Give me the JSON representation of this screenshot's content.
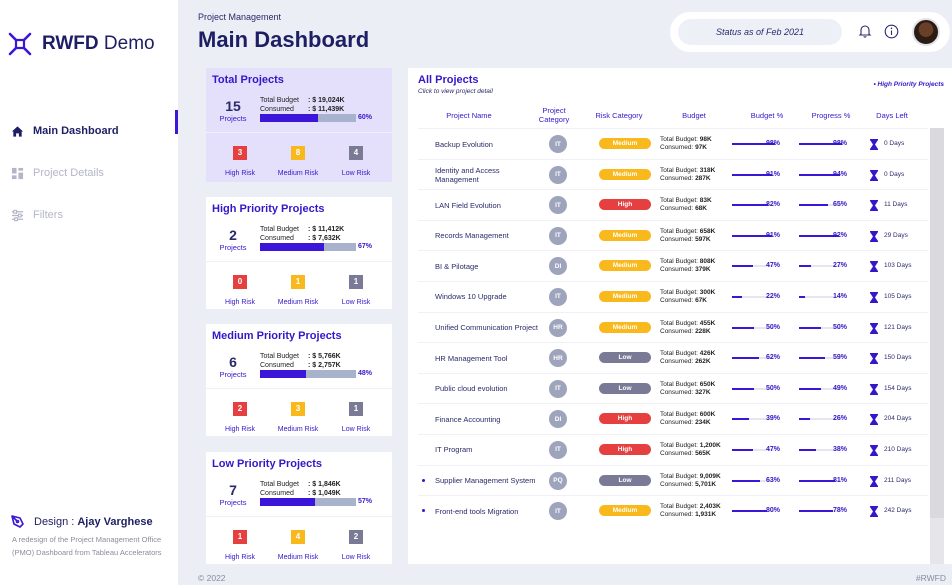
{
  "brand": {
    "bold": "RWFD",
    "rest": " Demo"
  },
  "nav": [
    {
      "label": "Main Dashboard",
      "icon": "home-icon",
      "active": true
    },
    {
      "label": "Project Details",
      "icon": "grid-icon",
      "active": false
    },
    {
      "label": "Filters",
      "icon": "sliders-icon",
      "active": false
    }
  ],
  "design": {
    "prefix": "Design : ",
    "author": "Ajay Varghese",
    "note": "A redesign of the Project Management Office (PMO) Dashboard from Tableau Accelerators"
  },
  "header": {
    "breadcrumb": "Project Management",
    "title": "Main Dashboard",
    "status": "Status as of Feb 2021"
  },
  "colors": {
    "accent": "#3b15d8",
    "high": "#e53f3f",
    "medium": "#f9b81c",
    "low": "#7a7a96",
    "category": "#9ea4bc"
  },
  "cards": [
    {
      "title": "Total Projects",
      "count": "15",
      "count_label": "Projects",
      "budget_key": "Total Budget",
      "budget": ": $ 19,024K",
      "consumed_key": "Consumed",
      "consumed": ": $ 11,439K",
      "pct": "60%",
      "fill": 0.6,
      "high": "3",
      "medium": "8",
      "low": "4",
      "high_label": "High Risk",
      "medium_label": "Medium Risk",
      "low_label": "Low Risk"
    },
    {
      "title": "High Priority Projects",
      "count": "2",
      "count_label": "Projects",
      "budget_key": "Total Budget",
      "budget": ": $ 11,412K",
      "consumed_key": "Consumed",
      "consumed": ": $ 7,632K",
      "pct": "67%",
      "fill": 0.67,
      "high": "0",
      "medium": "1",
      "low": "1",
      "high_label": "High Risk",
      "medium_label": "Medium Risk",
      "low_label": "Low Risk"
    },
    {
      "title": "Medium Priority Projects",
      "count": "6",
      "count_label": "Projects",
      "budget_key": "Total Budget",
      "budget": ": $ 5,766K",
      "consumed_key": "Consumed",
      "consumed": ": $ 2,757K",
      "pct": "48%",
      "fill": 0.48,
      "high": "2",
      "medium": "3",
      "low": "1",
      "high_label": "High Risk",
      "medium_label": "Medium Risk",
      "low_label": "Low Risk"
    },
    {
      "title": "Low Priority Projects",
      "count": "7",
      "count_label": "Projects",
      "budget_key": "Total Budget",
      "budget": ": $ 1,846K",
      "consumed_key": "Consumed",
      "consumed": ": $ 1,049K",
      "pct": "57%",
      "fill": 0.57,
      "high": "1",
      "medium": "4",
      "low": "2",
      "high_label": "High Risk",
      "medium_label": "Medium Risk",
      "low_label": "Low Risk"
    }
  ],
  "all_projects": {
    "title": "All Projects",
    "subtitle": "Click to view project detail",
    "legend": "High Priority Projects",
    "columns": [
      "Project Name",
      "Project Category",
      "Risk Category",
      "Budget",
      "Budget %",
      "Progress %",
      "Days Left"
    ],
    "budget_key": "Total Budget:",
    "consumed_key": "Consumed:",
    "rows": [
      {
        "name": "Backup Evolution",
        "cat": "IT",
        "risk": "Medium",
        "budget": "98K",
        "consumed": "97K",
        "bpct": "98%",
        "b": 0.98,
        "ppct": "98%",
        "p": 0.98,
        "days": "0 Days",
        "priority": false
      },
      {
        "name": "Identity and Access Management",
        "cat": "IT",
        "risk": "Medium",
        "budget": "318K",
        "consumed": "287K",
        "bpct": "91%",
        "b": 0.91,
        "ppct": "94%",
        "p": 0.94,
        "days": "0 Days",
        "priority": false
      },
      {
        "name": "LAN Field Evolution",
        "cat": "IT",
        "risk": "High",
        "budget": "83K",
        "consumed": "68K",
        "bpct": "82%",
        "b": 0.82,
        "ppct": "65%",
        "p": 0.65,
        "days": "11 Days",
        "priority": false
      },
      {
        "name": "Records Management",
        "cat": "IT",
        "risk": "Medium",
        "budget": "658K",
        "consumed": "597K",
        "bpct": "91%",
        "b": 0.91,
        "ppct": "92%",
        "p": 0.92,
        "days": "29 Days",
        "priority": false
      },
      {
        "name": "BI & Pilotage",
        "cat": "DI",
        "risk": "Medium",
        "budget": "808K",
        "consumed": "379K",
        "bpct": "47%",
        "b": 0.47,
        "ppct": "27%",
        "p": 0.27,
        "days": "103 Days",
        "priority": false
      },
      {
        "name": "Windows 10 Upgrade",
        "cat": "IT",
        "risk": "Medium",
        "budget": "300K",
        "consumed": "67K",
        "bpct": "22%",
        "b": 0.22,
        "ppct": "14%",
        "p": 0.14,
        "days": "105 Days",
        "priority": false
      },
      {
        "name": "Unified Communication Project",
        "cat": "HR",
        "risk": "Medium",
        "budget": "455K",
        "consumed": "228K",
        "bpct": "50%",
        "b": 0.5,
        "ppct": "50%",
        "p": 0.5,
        "days": "121 Days",
        "priority": false
      },
      {
        "name": "HR Management Tool",
        "cat": "HR",
        "risk": "Low",
        "budget": "426K",
        "consumed": "262K",
        "bpct": "62%",
        "b": 0.62,
        "ppct": "59%",
        "p": 0.59,
        "days": "150 Days",
        "priority": false
      },
      {
        "name": "Public cloud evolution",
        "cat": "IT",
        "risk": "Low",
        "budget": "650K",
        "consumed": "327K",
        "bpct": "50%",
        "b": 0.5,
        "ppct": "49%",
        "p": 0.49,
        "days": "154 Days",
        "priority": false
      },
      {
        "name": "Finance Accounting",
        "cat": "DI",
        "risk": "High",
        "budget": "600K",
        "consumed": "234K",
        "bpct": "39%",
        "b": 0.39,
        "ppct": "26%",
        "p": 0.26,
        "days": "204 Days",
        "priority": false
      },
      {
        "name": "IT Program",
        "cat": "IT",
        "risk": "High",
        "budget": "1,200K",
        "consumed": "565K",
        "bpct": "47%",
        "b": 0.47,
        "ppct": "38%",
        "p": 0.38,
        "days": "210 Days",
        "priority": false
      },
      {
        "name": "Supplier Management System",
        "cat": "PQ",
        "risk": "Low",
        "budget": "9,009K",
        "consumed": "5,701K",
        "bpct": "63%",
        "b": 0.63,
        "ppct": "81%",
        "p": 0.81,
        "days": "211 Days",
        "priority": true
      },
      {
        "name": "Front-end tools Migration",
        "cat": "IT",
        "risk": "Medium",
        "budget": "2,403K",
        "consumed": "1,931K",
        "bpct": "80%",
        "b": 0.8,
        "ppct": "78%",
        "p": 0.78,
        "days": "242 Days",
        "priority": true
      }
    ]
  },
  "footer": {
    "left": "© 2022",
    "right": "#RWFD"
  }
}
